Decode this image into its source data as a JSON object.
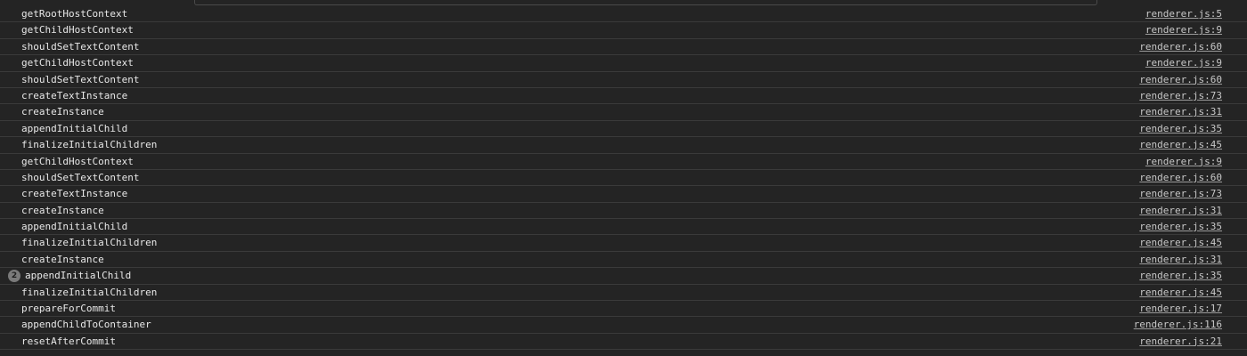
{
  "console": {
    "entries": [
      {
        "message": "getRootHostContext",
        "source": "renderer.js:5",
        "count": ""
      },
      {
        "message": "getChildHostContext",
        "source": "renderer.js:9",
        "count": ""
      },
      {
        "message": "shouldSetTextContent",
        "source": "renderer.js:60",
        "count": ""
      },
      {
        "message": "getChildHostContext",
        "source": "renderer.js:9",
        "count": ""
      },
      {
        "message": "shouldSetTextContent",
        "source": "renderer.js:60",
        "count": ""
      },
      {
        "message": "createTextInstance",
        "source": "renderer.js:73",
        "count": ""
      },
      {
        "message": "createInstance",
        "source": "renderer.js:31",
        "count": ""
      },
      {
        "message": "appendInitialChild",
        "source": "renderer.js:35",
        "count": ""
      },
      {
        "message": "finalizeInitialChildren",
        "source": "renderer.js:45",
        "count": ""
      },
      {
        "message": "getChildHostContext",
        "source": "renderer.js:9",
        "count": ""
      },
      {
        "message": "shouldSetTextContent",
        "source": "renderer.js:60",
        "count": ""
      },
      {
        "message": "createTextInstance",
        "source": "renderer.js:73",
        "count": ""
      },
      {
        "message": "createInstance",
        "source": "renderer.js:31",
        "count": ""
      },
      {
        "message": "appendInitialChild",
        "source": "renderer.js:35",
        "count": ""
      },
      {
        "message": "finalizeInitialChildren",
        "source": "renderer.js:45",
        "count": ""
      },
      {
        "message": "createInstance",
        "source": "renderer.js:31",
        "count": ""
      },
      {
        "message": "appendInitialChild",
        "source": "renderer.js:35",
        "count": "2"
      },
      {
        "message": "finalizeInitialChildren",
        "source": "renderer.js:45",
        "count": ""
      },
      {
        "message": "prepareForCommit",
        "source": "renderer.js:17",
        "count": ""
      },
      {
        "message": "appendChildToContainer",
        "source": "renderer.js:116",
        "count": ""
      },
      {
        "message": "resetAfterCommit",
        "source": "renderer.js:21",
        "count": ""
      }
    ]
  }
}
